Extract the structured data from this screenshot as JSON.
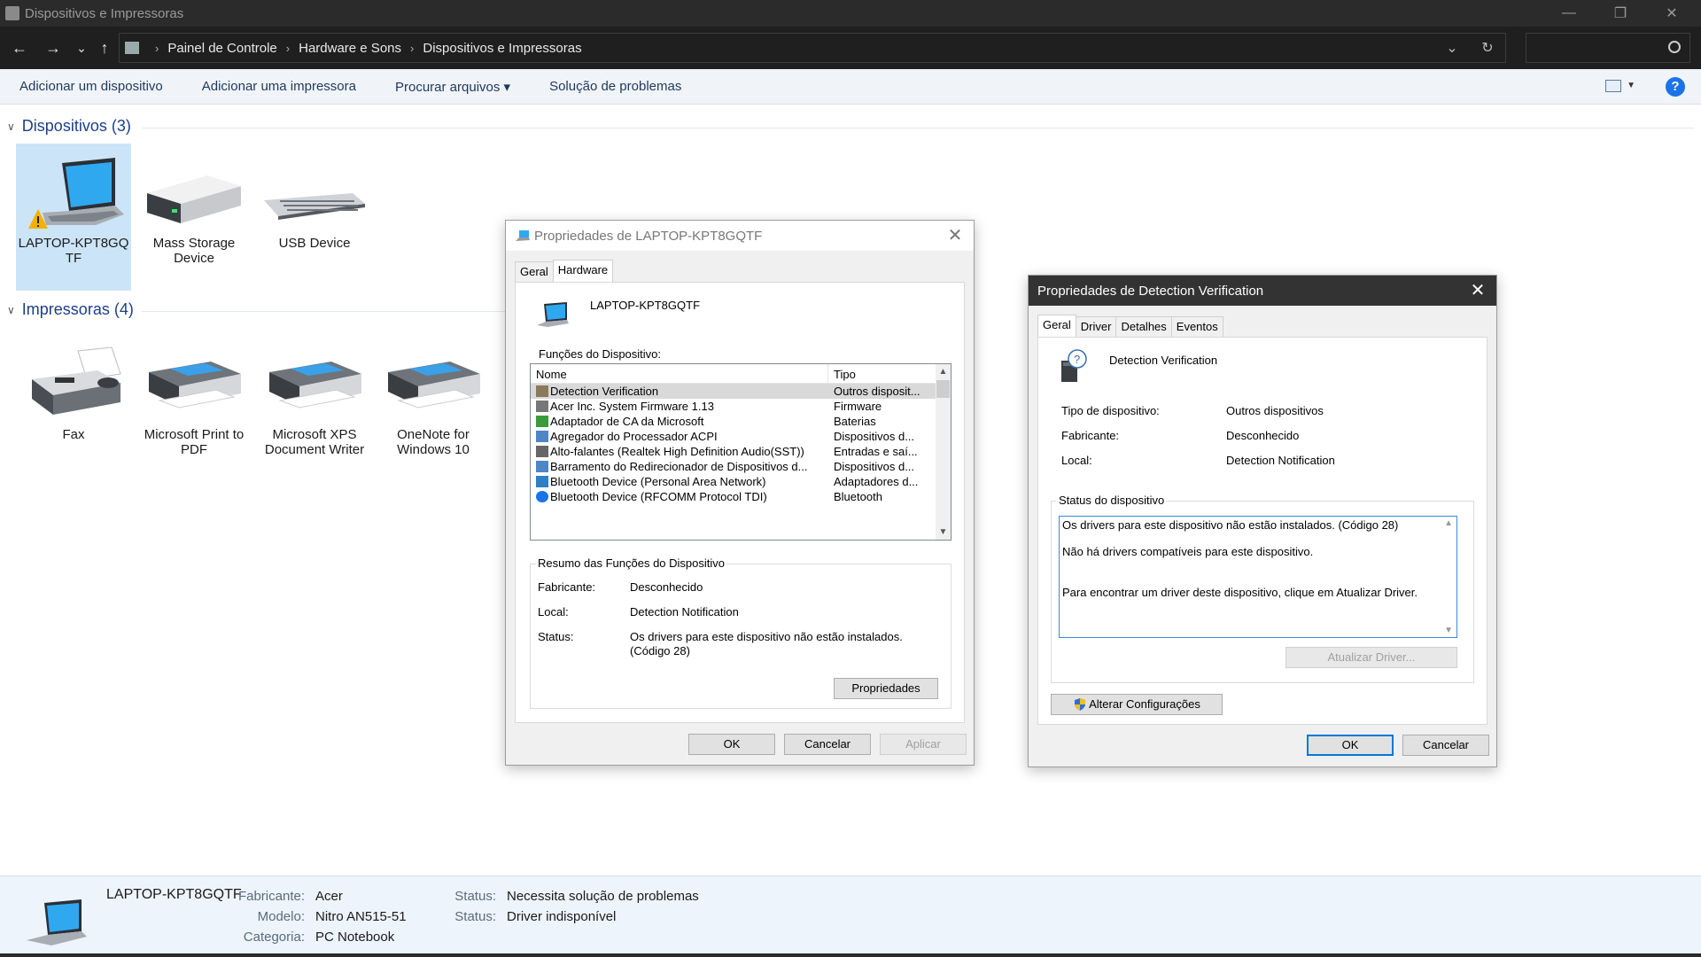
{
  "window": {
    "title": "Dispositivos e Impressoras",
    "controls": {
      "minimize": "—",
      "restore": "❐",
      "close": "✕"
    }
  },
  "nav": {
    "back": "←",
    "forward": "→",
    "recent": "⌄",
    "up": "↑"
  },
  "address": {
    "crumbs": [
      "Painel de Controle",
      "Hardware e Sons",
      "Dispositivos e Impressoras"
    ],
    "separator": "›",
    "dropdown": "⌄",
    "refresh": "↻"
  },
  "search": {
    "placeholder": ""
  },
  "commands": {
    "add_device": "Adicionar um dispositivo",
    "add_printer": "Adicionar uma impressora",
    "browse_files": "Procurar arquivos ▾",
    "troubleshoot": "Solução de problemas",
    "help": "?"
  },
  "devices": {
    "header": "Dispositivos (3)",
    "items": [
      {
        "label": "LAPTOP-KPT8GQ TF",
        "icon": "laptop-icon",
        "selected": true
      },
      {
        "label": "Mass Storage Device",
        "icon": "hard-drive-icon"
      },
      {
        "label": "USB Device",
        "icon": "keyboard-icon"
      }
    ]
  },
  "printers": {
    "header": "Impressoras (4)",
    "items": [
      {
        "label": "Fax",
        "icon": "fax-icon"
      },
      {
        "label": "Microsoft Print to PDF",
        "icon": "printer-icon"
      },
      {
        "label": "Microsoft XPS Document Writer",
        "icon": "printer-icon"
      },
      {
        "label": "OneNote for Windows 10",
        "icon": "printer-icon"
      }
    ]
  },
  "props_laptop": {
    "title": "Propriedades de LAPTOP-KPT8GQTF",
    "tabs": [
      "Geral",
      "Hardware"
    ],
    "device_name": "LAPTOP-KPT8GQTF",
    "functions_label": "Funções do Dispositivo:",
    "columns": [
      "Nome",
      "Tipo"
    ],
    "rows": [
      {
        "name": "Detection Verification",
        "type": "Outros disposit...",
        "icon": "warning-device-icon"
      },
      {
        "name": "Acer Inc. System Firmware 1.13",
        "type": "Firmware",
        "icon": "firmware-icon"
      },
      {
        "name": "Adaptador de CA da Microsoft",
        "type": "Baterias",
        "icon": "battery-icon"
      },
      {
        "name": "Agregador do Processador ACPI",
        "type": "Dispositivos d...",
        "icon": "system-device-icon"
      },
      {
        "name": "Alto-falantes (Realtek High Definition Audio(SST))",
        "type": "Entradas e saí...",
        "icon": "speaker-icon"
      },
      {
        "name": "Barramento do Redirecionador de Dispositivos d...",
        "type": "Dispositivos d...",
        "icon": "system-device-icon"
      },
      {
        "name": "Bluetooth Device (Personal Area Network)",
        "type": "Adaptadores d...",
        "icon": "network-adapter-icon"
      },
      {
        "name": "Bluetooth Device (RFCOMM Protocol TDI)",
        "type": "Bluetooth",
        "icon": "bluetooth-icon"
      }
    ],
    "summary": {
      "legend": "Resumo das Funções do Dispositivo",
      "manufacturer_label": "Fabricante:",
      "manufacturer": "Desconhecido",
      "location_label": "Local:",
      "location": "Detection Notification",
      "status_label": "Status:",
      "status": "Os drivers para este dispositivo não estão instalados. (Código 28)",
      "properties_button": "Propriedades"
    },
    "buttons": {
      "ok": "OK",
      "cancel": "Cancelar",
      "apply": "Aplicar"
    }
  },
  "props_detection": {
    "title": "Propriedades de Detection Verification",
    "tabs": [
      "Geral",
      "Driver",
      "Detalhes",
      "Eventos"
    ],
    "device_name": "Detection Verification",
    "type_label": "Tipo de dispositivo:",
    "type": "Outros dispositivos",
    "manufacturer_label": "Fabricante:",
    "manufacturer": "Desconhecido",
    "location_label": "Local:",
    "location": "Detection Notification",
    "status_legend": "Status do dispositivo",
    "status_line1": "Os drivers para este dispositivo não estão instalados. (Código 28)",
    "status_line2": "Não há drivers compatíveis para este dispositivo.",
    "status_line3": "Para encontrar um driver deste dispositivo, clique em Atualizar Driver.",
    "update_driver": "Atualizar Driver...",
    "change_settings": "Alterar Configurações",
    "buttons": {
      "ok": "OK",
      "cancel": "Cancelar"
    }
  },
  "details_pane": {
    "name": "LAPTOP-KPT8GQTF",
    "manufacturer_label": "Fabricante:",
    "manufacturer": "Acer",
    "model_label": "Modelo:",
    "model": "Nitro AN515-51",
    "category_label": "Categoria:",
    "category": "PC Notebook",
    "status1_label": "Status:",
    "status1": "Necessita solução de problemas",
    "status2_label": "Status:",
    "status2": "Driver indisponível"
  },
  "colors": {
    "accent": "#0078d7",
    "link": "#1e3e8a",
    "titlebar": "#2b2b2b"
  }
}
